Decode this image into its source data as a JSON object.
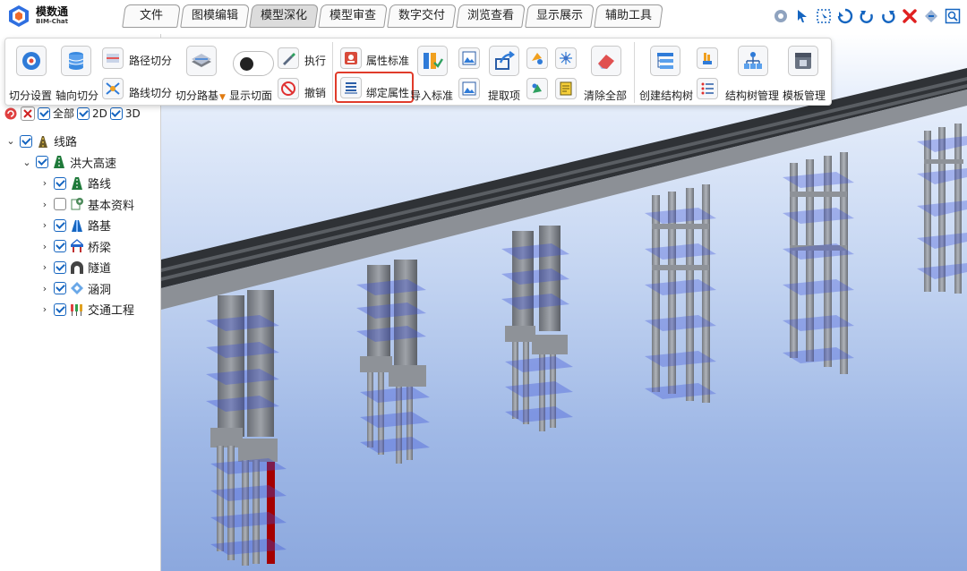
{
  "app": {
    "name": "模数通",
    "subtitle": "BIM-Chat"
  },
  "menu": {
    "tabs": [
      {
        "label": "文件"
      },
      {
        "label": "图模编辑"
      },
      {
        "label": "模型深化"
      },
      {
        "label": "模型审查"
      },
      {
        "label": "数字交付"
      },
      {
        "label": "浏览查看"
      },
      {
        "label": "显示展示"
      },
      {
        "label": "辅助工具"
      }
    ],
    "active": "模型深化"
  },
  "quick_icons": [
    "settings-icon",
    "pointer-icon",
    "box-select-icon",
    "refresh-icon",
    "undo-icon",
    "redo-icon",
    "close-icon",
    "expand-icon",
    "zoom-fit-icon"
  ],
  "ribbon": {
    "cut_settings": "切分设置",
    "axial_cut": "轴向切分",
    "path_cut": "路径切分",
    "route_cut": "路线切分",
    "cut_subgrade": "切分路基",
    "show_section": "显示切面",
    "execute": "执行",
    "revoke": "撤销",
    "attr_standard": "属性标准",
    "bind_attr": "绑定属性",
    "import_standard": "导入标准",
    "extract_item": "提取项",
    "clear_all": "清除全部",
    "create_tree": "创建结构树",
    "tree_manage": "结构树管理",
    "template_manage": "模板管理"
  },
  "tree_toolbar": {
    "all": "全部",
    "two_d": "2D",
    "three_d": "3D"
  },
  "tree": {
    "root": {
      "label": "线路",
      "checked": true
    },
    "project": {
      "label": "洪大高速",
      "checked": true
    },
    "children": [
      {
        "label": "路线",
        "checked": true
      },
      {
        "label": "基本资料",
        "checked": false
      },
      {
        "label": "路基",
        "checked": true
      },
      {
        "label": "桥梁",
        "checked": true
      },
      {
        "label": "隧道",
        "checked": true
      },
      {
        "label": "涵洞",
        "checked": true
      },
      {
        "label": "交通工程",
        "checked": true
      }
    ]
  },
  "colors": {
    "accent": "#1565c0",
    "highlight": "#e03b2a",
    "selected_pile": "#a40000",
    "deck": "#3a3d42"
  }
}
